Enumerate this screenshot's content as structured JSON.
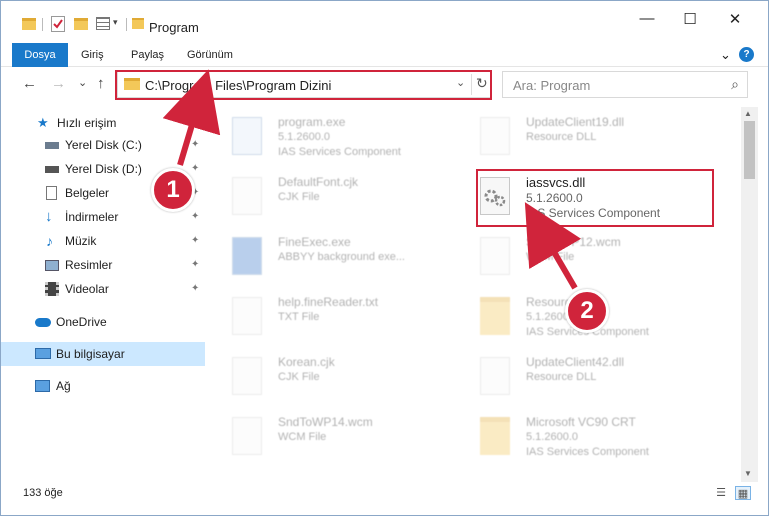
{
  "window": {
    "title": "Program",
    "minimize_glyph": "—",
    "maximize_glyph": "☐",
    "close_glyph": "✕"
  },
  "ribbon": {
    "file_tab": "Dosya",
    "tabs": [
      "Giriş",
      "Paylaş",
      "Görünüm"
    ],
    "expand_glyph": "⌄",
    "help_glyph": "?"
  },
  "address": {
    "path": "C:\\Program Files\\Program Dizini",
    "dropdown_glyph": "⌄",
    "refresh_glyph": "↻"
  },
  "search": {
    "placeholder": "Ara: Program",
    "icon_glyph": "⌕"
  },
  "nav": {
    "back_glyph": "←",
    "forward_glyph": "→",
    "recent_glyph": "⌄",
    "up_glyph": "↑"
  },
  "sidebar": {
    "quick_access": "Hızlı erişim",
    "items": [
      {
        "label": "Yerel Disk (C:)",
        "pinned": true
      },
      {
        "label": "Yerel Disk (D:)",
        "pinned": true
      },
      {
        "label": "Belgeler",
        "pinned": true
      },
      {
        "label": "İndirmeler",
        "pinned": true
      },
      {
        "label": "Müzik",
        "pinned": true
      },
      {
        "label": "Resimler",
        "pinned": true
      },
      {
        "label": "Videolar",
        "pinned": true
      }
    ],
    "onedrive": "OneDrive",
    "this_pc": "Bu bilgisayar",
    "network": "Ağ",
    "pin_glyph": "📌"
  },
  "files": {
    "left_column": [
      {
        "name": "program.exe",
        "line1": "5.1.2600.0",
        "line2": "IAS Services Component",
        "kind": "exe"
      },
      {
        "name": "DefaultFont.cjk",
        "line1": "CJK File",
        "line2": "",
        "kind": "doc"
      },
      {
        "name": "FineExec.exe",
        "line1": "ABBYY background exe...",
        "line2": "",
        "kind": "exe"
      },
      {
        "name": "help.fineReader.txt",
        "line1": "TXT File",
        "line2": "",
        "kind": "doc"
      },
      {
        "name": "Korean.cjk",
        "line1": "CJK File",
        "line2": "",
        "kind": "doc"
      },
      {
        "name": "SndToWP14.wcm",
        "line1": "WCM File",
        "line2": "",
        "kind": "doc"
      }
    ],
    "right_column": [
      {
        "name": "UpdateClient19.dll",
        "line1": "Resource DLL",
        "line2": "",
        "kind": "dll"
      },
      {
        "name": "iassvcs.dll",
        "line1": "5.1.2600.0",
        "line2": "IAS Services Component",
        "kind": "dll"
      },
      {
        "name": "SndToWP12.wcm",
        "line1": "WCM File",
        "line2": "",
        "kind": "doc"
      },
      {
        "name": "Resources",
        "line1": "5.1.2600.0",
        "line2": "IAS Services Component",
        "kind": "folder"
      },
      {
        "name": "UpdateClient42.dll",
        "line1": "Resource DLL",
        "line2": "",
        "kind": "dll"
      },
      {
        "name": "Microsoft VC90 CRT",
        "line1": "5.1.2600.0",
        "line2": "IAS Services Component",
        "kind": "folder"
      }
    ]
  },
  "status": {
    "item_count": "133 öğe"
  },
  "annotations": {
    "step1": "1",
    "step2": "2",
    "color": "#d0243b"
  }
}
